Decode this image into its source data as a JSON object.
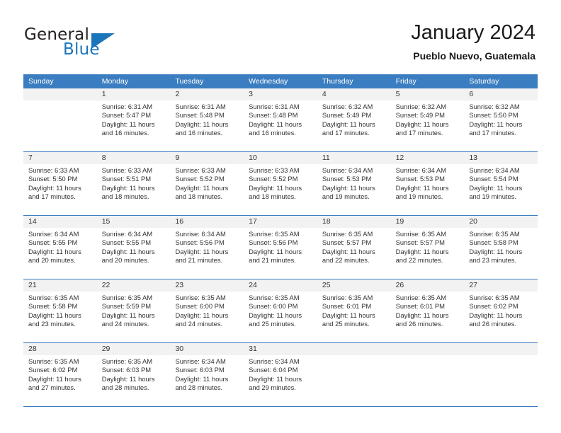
{
  "brand": {
    "name_part1": "General",
    "name_part2": "Blue",
    "accent_color": "#1b75bb"
  },
  "header": {
    "title": "January 2024",
    "location": "Pueblo Nuevo, Guatemala"
  },
  "theme": {
    "header_row_bg": "#3a7dc0",
    "date_row_bg": "#f2f2f2",
    "text_color": "#333333"
  },
  "weekdays": [
    "Sunday",
    "Monday",
    "Tuesday",
    "Wednesday",
    "Thursday",
    "Friday",
    "Saturday"
  ],
  "weeks": [
    {
      "days": [
        {
          "date": "",
          "lines": []
        },
        {
          "date": "1",
          "lines": [
            "Sunrise: 6:31 AM",
            "Sunset: 5:47 PM",
            "Daylight: 11 hours",
            "and 16 minutes."
          ]
        },
        {
          "date": "2",
          "lines": [
            "Sunrise: 6:31 AM",
            "Sunset: 5:48 PM",
            "Daylight: 11 hours",
            "and 16 minutes."
          ]
        },
        {
          "date": "3",
          "lines": [
            "Sunrise: 6:31 AM",
            "Sunset: 5:48 PM",
            "Daylight: 11 hours",
            "and 16 minutes."
          ]
        },
        {
          "date": "4",
          "lines": [
            "Sunrise: 6:32 AM",
            "Sunset: 5:49 PM",
            "Daylight: 11 hours",
            "and 17 minutes."
          ]
        },
        {
          "date": "5",
          "lines": [
            "Sunrise: 6:32 AM",
            "Sunset: 5:49 PM",
            "Daylight: 11 hours",
            "and 17 minutes."
          ]
        },
        {
          "date": "6",
          "lines": [
            "Sunrise: 6:32 AM",
            "Sunset: 5:50 PM",
            "Daylight: 11 hours",
            "and 17 minutes."
          ]
        }
      ]
    },
    {
      "days": [
        {
          "date": "7",
          "lines": [
            "Sunrise: 6:33 AM",
            "Sunset: 5:50 PM",
            "Daylight: 11 hours",
            "and 17 minutes."
          ]
        },
        {
          "date": "8",
          "lines": [
            "Sunrise: 6:33 AM",
            "Sunset: 5:51 PM",
            "Daylight: 11 hours",
            "and 18 minutes."
          ]
        },
        {
          "date": "9",
          "lines": [
            "Sunrise: 6:33 AM",
            "Sunset: 5:52 PM",
            "Daylight: 11 hours",
            "and 18 minutes."
          ]
        },
        {
          "date": "10",
          "lines": [
            "Sunrise: 6:33 AM",
            "Sunset: 5:52 PM",
            "Daylight: 11 hours",
            "and 18 minutes."
          ]
        },
        {
          "date": "11",
          "lines": [
            "Sunrise: 6:34 AM",
            "Sunset: 5:53 PM",
            "Daylight: 11 hours",
            "and 19 minutes."
          ]
        },
        {
          "date": "12",
          "lines": [
            "Sunrise: 6:34 AM",
            "Sunset: 5:53 PM",
            "Daylight: 11 hours",
            "and 19 minutes."
          ]
        },
        {
          "date": "13",
          "lines": [
            "Sunrise: 6:34 AM",
            "Sunset: 5:54 PM",
            "Daylight: 11 hours",
            "and 19 minutes."
          ]
        }
      ]
    },
    {
      "days": [
        {
          "date": "14",
          "lines": [
            "Sunrise: 6:34 AM",
            "Sunset: 5:55 PM",
            "Daylight: 11 hours",
            "and 20 minutes."
          ]
        },
        {
          "date": "15",
          "lines": [
            "Sunrise: 6:34 AM",
            "Sunset: 5:55 PM",
            "Daylight: 11 hours",
            "and 20 minutes."
          ]
        },
        {
          "date": "16",
          "lines": [
            "Sunrise: 6:34 AM",
            "Sunset: 5:56 PM",
            "Daylight: 11 hours",
            "and 21 minutes."
          ]
        },
        {
          "date": "17",
          "lines": [
            "Sunrise: 6:35 AM",
            "Sunset: 5:56 PM",
            "Daylight: 11 hours",
            "and 21 minutes."
          ]
        },
        {
          "date": "18",
          "lines": [
            "Sunrise: 6:35 AM",
            "Sunset: 5:57 PM",
            "Daylight: 11 hours",
            "and 22 minutes."
          ]
        },
        {
          "date": "19",
          "lines": [
            "Sunrise: 6:35 AM",
            "Sunset: 5:57 PM",
            "Daylight: 11 hours",
            "and 22 minutes."
          ]
        },
        {
          "date": "20",
          "lines": [
            "Sunrise: 6:35 AM",
            "Sunset: 5:58 PM",
            "Daylight: 11 hours",
            "and 23 minutes."
          ]
        }
      ]
    },
    {
      "days": [
        {
          "date": "21",
          "lines": [
            "Sunrise: 6:35 AM",
            "Sunset: 5:58 PM",
            "Daylight: 11 hours",
            "and 23 minutes."
          ]
        },
        {
          "date": "22",
          "lines": [
            "Sunrise: 6:35 AM",
            "Sunset: 5:59 PM",
            "Daylight: 11 hours",
            "and 24 minutes."
          ]
        },
        {
          "date": "23",
          "lines": [
            "Sunrise: 6:35 AM",
            "Sunset: 6:00 PM",
            "Daylight: 11 hours",
            "and 24 minutes."
          ]
        },
        {
          "date": "24",
          "lines": [
            "Sunrise: 6:35 AM",
            "Sunset: 6:00 PM",
            "Daylight: 11 hours",
            "and 25 minutes."
          ]
        },
        {
          "date": "25",
          "lines": [
            "Sunrise: 6:35 AM",
            "Sunset: 6:01 PM",
            "Daylight: 11 hours",
            "and 25 minutes."
          ]
        },
        {
          "date": "26",
          "lines": [
            "Sunrise: 6:35 AM",
            "Sunset: 6:01 PM",
            "Daylight: 11 hours",
            "and 26 minutes."
          ]
        },
        {
          "date": "27",
          "lines": [
            "Sunrise: 6:35 AM",
            "Sunset: 6:02 PM",
            "Daylight: 11 hours",
            "and 26 minutes."
          ]
        }
      ]
    },
    {
      "days": [
        {
          "date": "28",
          "lines": [
            "Sunrise: 6:35 AM",
            "Sunset: 6:02 PM",
            "Daylight: 11 hours",
            "and 27 minutes."
          ]
        },
        {
          "date": "29",
          "lines": [
            "Sunrise: 6:35 AM",
            "Sunset: 6:03 PM",
            "Daylight: 11 hours",
            "and 28 minutes."
          ]
        },
        {
          "date": "30",
          "lines": [
            "Sunrise: 6:34 AM",
            "Sunset: 6:03 PM",
            "Daylight: 11 hours",
            "and 28 minutes."
          ]
        },
        {
          "date": "31",
          "lines": [
            "Sunrise: 6:34 AM",
            "Sunset: 6:04 PM",
            "Daylight: 11 hours",
            "and 29 minutes."
          ]
        },
        {
          "date": "",
          "lines": []
        },
        {
          "date": "",
          "lines": []
        },
        {
          "date": "",
          "lines": []
        }
      ]
    }
  ]
}
